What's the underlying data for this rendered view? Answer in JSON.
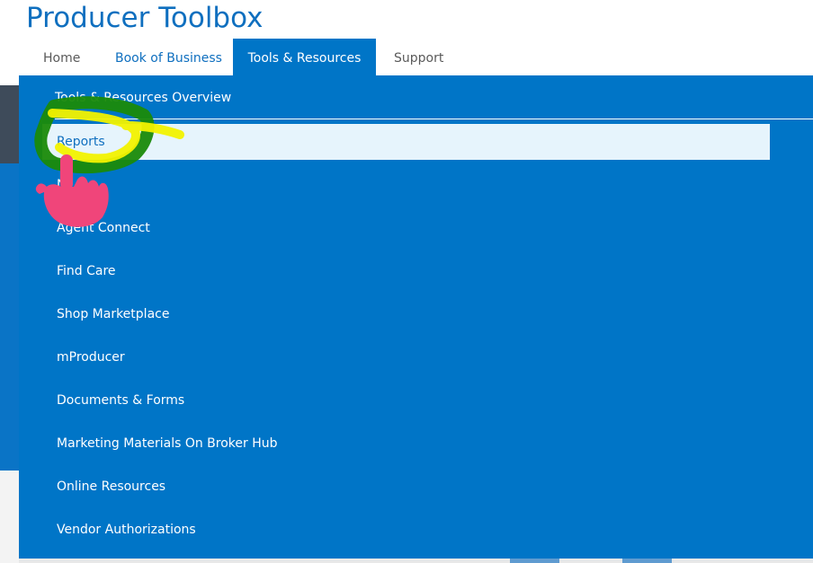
{
  "header": {
    "title": "Producer Toolbox"
  },
  "nav": {
    "tabs": [
      {
        "label": "Home"
      },
      {
        "label": "Book of Business"
      },
      {
        "label": "Tools & Resources"
      },
      {
        "label": "Support"
      }
    ]
  },
  "dropdown": {
    "overview": "Tools & Resources Overview",
    "items": [
      {
        "label": "Reports"
      },
      {
        "label": "N"
      },
      {
        "label": "Agent Connect"
      },
      {
        "label": "Find Care"
      },
      {
        "label": "Shop Marketplace"
      },
      {
        "label": "mProducer"
      },
      {
        "label": "Documents & Forms"
      },
      {
        "label": "Marketing Materials On Broker Hub"
      },
      {
        "label": "Online Resources"
      },
      {
        "label": "Vendor Authorizations"
      }
    ]
  },
  "colors": {
    "brand_blue": "#0075c7",
    "title_blue": "#0f6fbf",
    "highlight_bg": "#e6f4fc",
    "annotation_green": "#1a8a0a",
    "annotation_yellow": "#f2f200",
    "annotation_pink": "#f0457a"
  },
  "icons": {
    "pointer": "pointing-hand-icon"
  }
}
